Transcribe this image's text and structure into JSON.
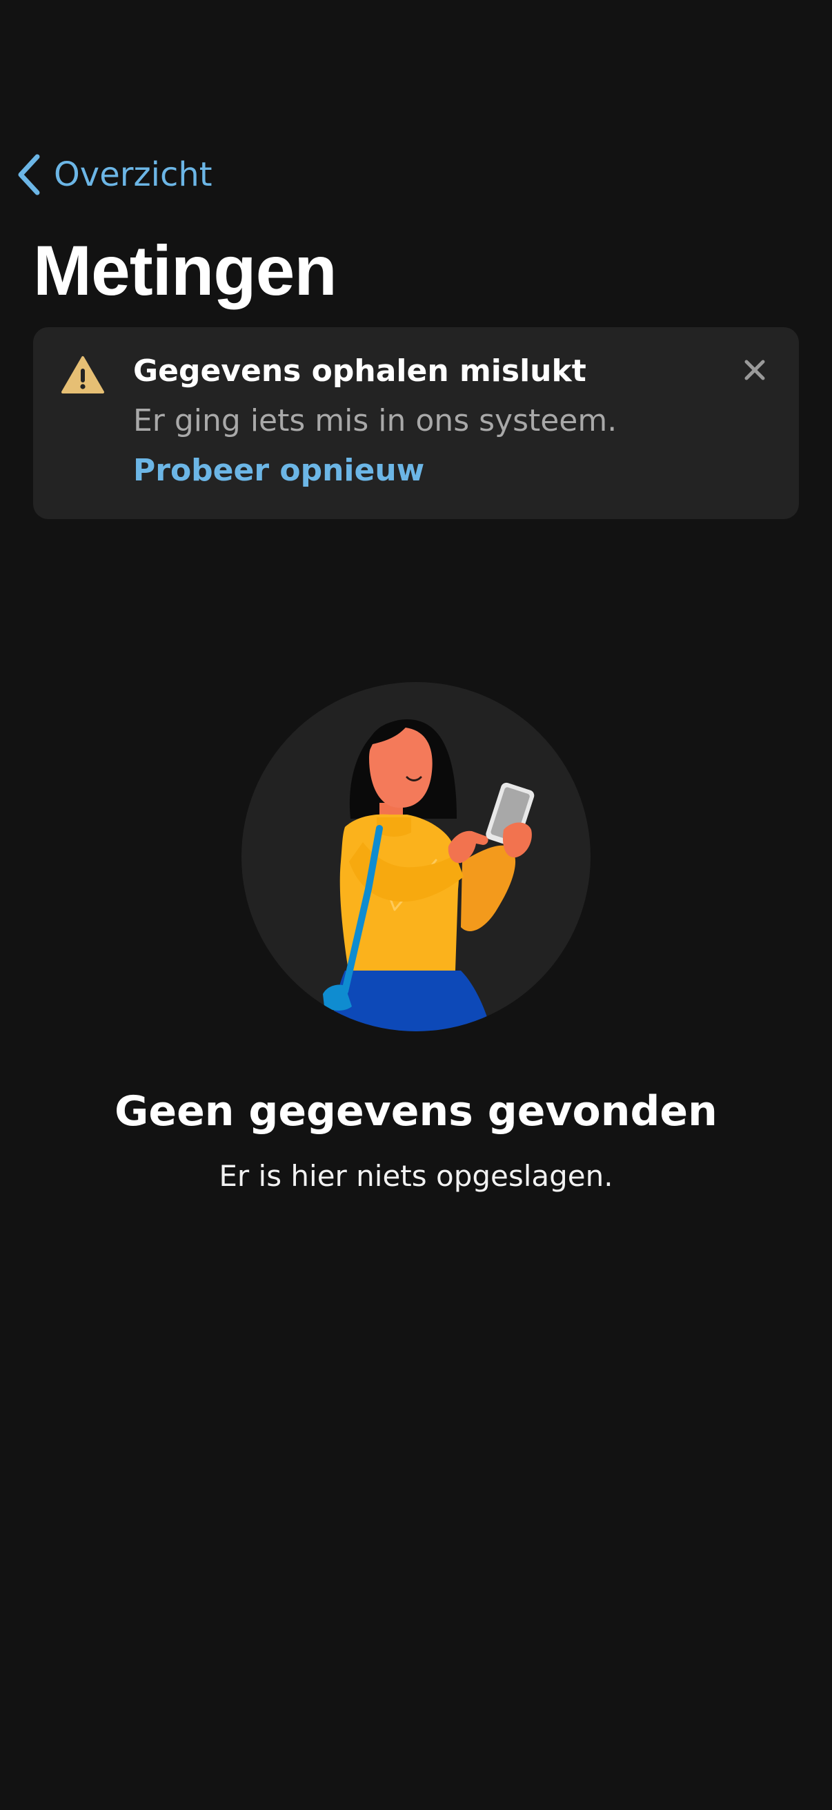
{
  "nav": {
    "back_label": "Overzicht",
    "back_icon": "chevron-left-icon"
  },
  "page": {
    "title": "Metingen"
  },
  "alert": {
    "icon": "warning-icon",
    "title": "Gegevens ophalen mislukt",
    "message": "Er ging iets mis in ons systeem.",
    "action_label": "Probeer opnieuw",
    "close_icon": "close-icon"
  },
  "empty_state": {
    "illustration": "woman-with-phone-illustration",
    "title": "Geen gegevens gevonden",
    "subtitle": "Er is hier niets opgeslagen."
  },
  "colors": {
    "background": "#121212",
    "card": "#232323",
    "accent": "#6cb6e6",
    "warning": "#e6bf74"
  }
}
